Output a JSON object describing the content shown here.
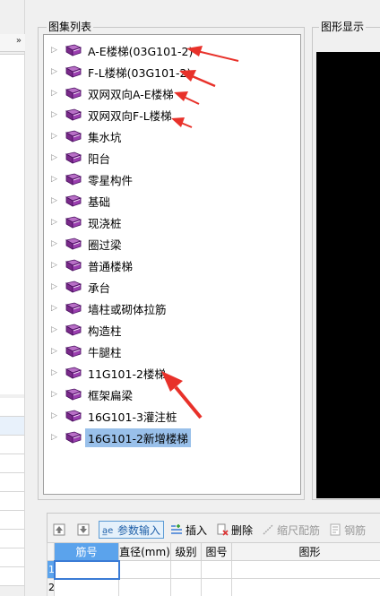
{
  "tree": {
    "group_title": "图集列表",
    "items": [
      {
        "label": "A-E楼梯(03G101-2)"
      },
      {
        "label": "F-L楼梯(03G101-2)"
      },
      {
        "label": "双网双向A-E楼梯"
      },
      {
        "label": "双网双向F-L楼梯"
      },
      {
        "label": "集水坑"
      },
      {
        "label": "阳台"
      },
      {
        "label": "零星构件"
      },
      {
        "label": "基础"
      },
      {
        "label": "现浇桩"
      },
      {
        "label": "圈过梁"
      },
      {
        "label": "普通楼梯"
      },
      {
        "label": "承台"
      },
      {
        "label": "墙柱或砌体拉筋"
      },
      {
        "label": "构造柱"
      },
      {
        "label": "牛腿柱"
      },
      {
        "label": "11G101-2楼梯"
      },
      {
        "label": "框架扁梁"
      },
      {
        "label": "16G101-3灌注桩"
      },
      {
        "label": "16G101-2新增楼梯"
      }
    ],
    "selected_index": 18
  },
  "display": {
    "title": "图形显示"
  },
  "toolbar": {
    "param_input": "参数输入",
    "insert": "插入",
    "delete": "删除",
    "scale_rebar": "缩尺配筋",
    "rebar_info": "钢筋"
  },
  "grid": {
    "headers": [
      "筋号",
      "直径(mm)",
      "级别",
      "图号",
      "图形"
    ],
    "rows": [
      {
        "num": "1"
      },
      {
        "num": "2"
      }
    ]
  },
  "colors": {
    "accent": "#5ba3ec",
    "selection": "#99c0ea",
    "book": "#7a2a8a",
    "annotation": "#e8312a"
  }
}
